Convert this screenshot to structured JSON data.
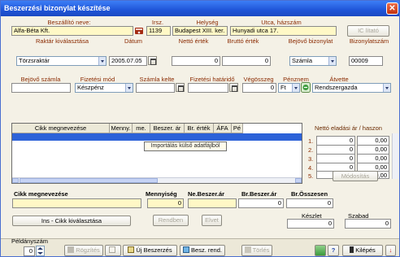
{
  "window": {
    "title": "Beszerzési bizonylat készítése",
    "close_glyph": "✕"
  },
  "header": {
    "supplier_label": "Beszállító neve:",
    "supplier_value": "Alfa-Béta Kft.",
    "zip_label": "Irsz.",
    "zip_value": "1139",
    "city_label": "Helység",
    "city_value": "Budapest XIII. ker.",
    "street_label": "Utca, házszám",
    "street_value": "Hunyadi utca 17.",
    "ic_button": "IC lítató"
  },
  "row2": {
    "warehouse_label": "Raktár kiválasztása",
    "warehouse_value": "Törzsraktár",
    "date_label": "Dátum",
    "date_value": "2005.07.05",
    "net_label": "Nettó érték",
    "net_value": "0",
    "gross_label": "Bruttó érték",
    "gross_value": "0",
    "incoming_doc_label": "Bejövő bizonylat",
    "incoming_doc_value": "Számla",
    "doc_no_label": "Bizonylatszám",
    "doc_no_value": "00009"
  },
  "row3": {
    "invoice_label": "Bejövő számla",
    "invoice_value": "",
    "payment_label": "Fizetési mód",
    "payment_value": "Készpénz",
    "invoice_date_label": "Számla kelte",
    "invoice_date_value": "",
    "due_label": "Fizetési határidő",
    "due_value": "",
    "total_label": "Végösszeg",
    "total_value": "0",
    "currency_label": "Pénznem",
    "currency_value": "Ft",
    "receiver_label": "Átvette",
    "receiver_value": "Rendszergazda"
  },
  "grid": {
    "columns": [
      "Cikk megnevezése",
      "Menny.",
      "me.",
      "Beszer. ár",
      "Br. érték",
      "ÁFA",
      "Pé"
    ],
    "context_menu": "Importálás külső adatfájlból"
  },
  "price_panel": {
    "title": "Nettó eladási ár / haszon",
    "rows": [
      {
        "n": "1.",
        "price": "0",
        "margin": "0,00"
      },
      {
        "n": "2.",
        "price": "0",
        "margin": "0,00"
      },
      {
        "n": "3.",
        "price": "0",
        "margin": "0,00"
      },
      {
        "n": "4.",
        "price": "0",
        "margin": "0,00"
      },
      {
        "n": "5.",
        "price": "0",
        "margin": "0,00"
      }
    ],
    "modify_button": "Módosítás"
  },
  "entry": {
    "item_label": "Cikk megnevezése",
    "qty_label": "Mennyiség",
    "net_price_label": "Ne.Beszer.ár",
    "gross_price_label": "Br.Beszer.ár",
    "gross_total_label": "Br.Összesen",
    "qty_value": "0",
    "net_price_value": "",
    "gross_price_value": "0",
    "gross_total_value": "0",
    "select_button": "Ins - Cikk kiválasztása",
    "ok_button": "Rendben",
    "cancel_button": "Elvet",
    "stock_label": "Készlet",
    "stock_value": "0",
    "free_label": "Szabad",
    "free_value": "0"
  },
  "footer": {
    "copies_label": "Példányszám",
    "copies_value": "0",
    "record_button": "Rögzítés",
    "new_purchase_button": "Új Beszerzés",
    "purchase_order_button": "Besz. rend.",
    "delete_button": "Törlés",
    "help_glyph": "?",
    "exit_button": "Kilépés"
  }
}
